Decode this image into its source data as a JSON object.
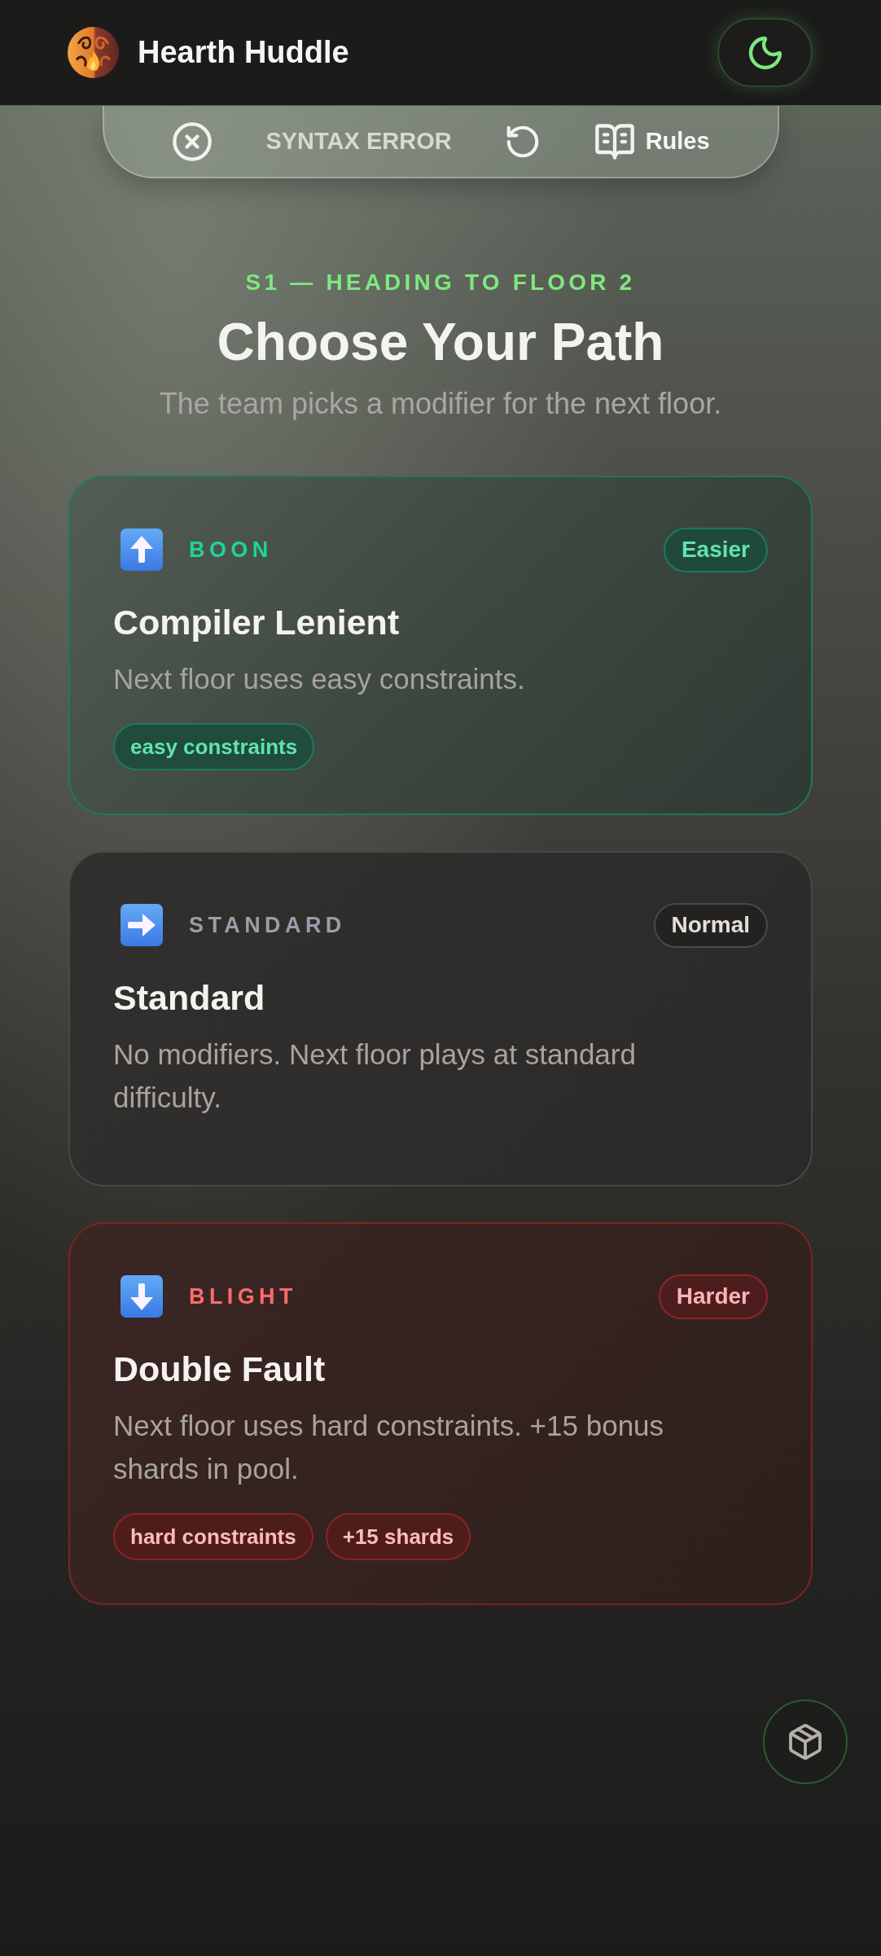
{
  "header": {
    "title": "Hearth Huddle"
  },
  "toolbar": {
    "status": "SYNTAX ERROR",
    "rules_label": "Rules"
  },
  "intro": {
    "eyebrow": "S1 — HEADING TO FLOOR 2",
    "title": "Choose Your Path",
    "subtitle": "The team picks a modifier for the next floor."
  },
  "paths": [
    {
      "kind": "boon",
      "category": "BOON",
      "badge": "Easier",
      "title": "Compiler Lenient",
      "description": "Next floor uses easy constraints.",
      "tags": [
        "easy constraints"
      ]
    },
    {
      "kind": "standard",
      "category": "STANDARD",
      "badge": "Normal",
      "title": "Standard",
      "description": "No modifiers. Next floor plays at standard difficulty."
    },
    {
      "kind": "blight",
      "category": "BLIGHT",
      "badge": "Harder",
      "title": "Double Fault",
      "description": "Next floor uses hard constraints. +15 bonus shards in pool.",
      "tags": [
        "hard constraints",
        "+15 shards"
      ]
    }
  ]
}
